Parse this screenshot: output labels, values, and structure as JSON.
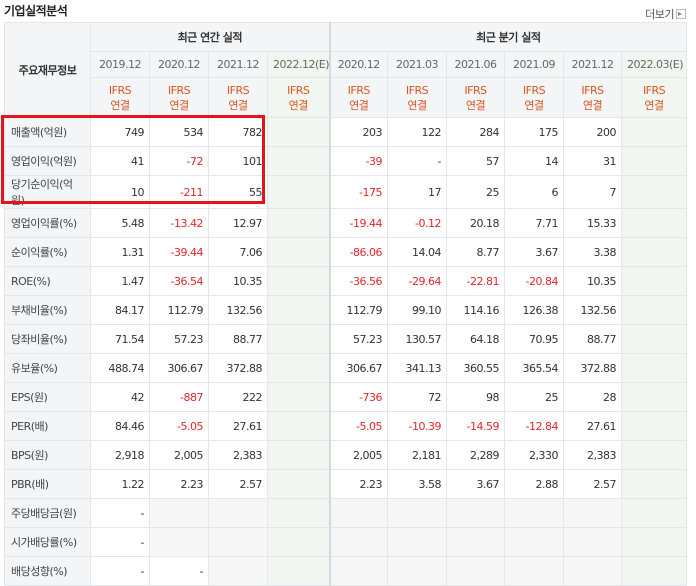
{
  "header": {
    "title": "기업실적분석",
    "more_label": "더보기"
  },
  "table": {
    "label_header": "주요재무정보",
    "group_annual": "최근 연간 실적",
    "group_quarter": "최근 분기 실적",
    "annual_periods": [
      "2019.12",
      "2020.12",
      "2021.12",
      "2022.12(E)"
    ],
    "quarter_periods": [
      "2020.12",
      "2021.03",
      "2021.06",
      "2021.09",
      "2021.12",
      "2022.03(E)"
    ],
    "basis_line1": "IFRS",
    "basis_line2": "연결",
    "rows": [
      {
        "label": "매출액(억원)",
        "annual": [
          "749",
          "534",
          "782",
          ""
        ],
        "quarter": [
          "203",
          "122",
          "284",
          "175",
          "200",
          ""
        ]
      },
      {
        "label": "영업이익(억원)",
        "annual": [
          "41",
          "-72",
          "101",
          ""
        ],
        "quarter": [
          "-39",
          "-",
          "57",
          "14",
          "31",
          ""
        ]
      },
      {
        "label": "당기순이익(억원)",
        "annual": [
          "10",
          "-211",
          "55",
          ""
        ],
        "quarter": [
          "-175",
          "17",
          "25",
          "6",
          "7",
          ""
        ]
      },
      {
        "label": "영업이익률(%)",
        "annual": [
          "5.48",
          "-13.42",
          "12.97",
          ""
        ],
        "quarter": [
          "-19.44",
          "-0.12",
          "20.18",
          "7.71",
          "15.33",
          ""
        ]
      },
      {
        "label": "순이익률(%)",
        "annual": [
          "1.31",
          "-39.44",
          "7.06",
          ""
        ],
        "quarter": [
          "-86.06",
          "14.04",
          "8.77",
          "3.67",
          "3.38",
          ""
        ]
      },
      {
        "label": "ROE(%)",
        "annual": [
          "1.47",
          "-36.54",
          "10.35",
          ""
        ],
        "quarter": [
          "-36.56",
          "-29.64",
          "-22.81",
          "-20.84",
          "10.35",
          ""
        ]
      },
      {
        "label": "부채비율(%)",
        "annual": [
          "84.17",
          "112.79",
          "132.56",
          ""
        ],
        "quarter": [
          "112.79",
          "99.10",
          "114.16",
          "126.38",
          "132.56",
          ""
        ]
      },
      {
        "label": "당좌비율(%)",
        "annual": [
          "71.54",
          "57.23",
          "88.77",
          ""
        ],
        "quarter": [
          "57.23",
          "130.57",
          "64.18",
          "70.95",
          "88.77",
          ""
        ]
      },
      {
        "label": "유보율(%)",
        "annual": [
          "488.74",
          "306.67",
          "372.88",
          ""
        ],
        "quarter": [
          "306.67",
          "341.13",
          "360.55",
          "365.54",
          "372.88",
          ""
        ]
      },
      {
        "label": "EPS(원)",
        "annual": [
          "42",
          "-887",
          "222",
          ""
        ],
        "quarter": [
          "-736",
          "72",
          "98",
          "25",
          "28",
          ""
        ]
      },
      {
        "label": "PER(배)",
        "annual": [
          "84.46",
          "-5.05",
          "27.61",
          ""
        ],
        "quarter": [
          "-5.05",
          "-10.39",
          "-14.59",
          "-12.84",
          "27.61",
          ""
        ]
      },
      {
        "label": "BPS(원)",
        "annual": [
          "2,918",
          "2,005",
          "2,383",
          ""
        ],
        "quarter": [
          "2,005",
          "2,181",
          "2,289",
          "2,330",
          "2,383",
          ""
        ]
      },
      {
        "label": "PBR(배)",
        "annual": [
          "1.22",
          "2.23",
          "2.57",
          ""
        ],
        "quarter": [
          "2.23",
          "3.58",
          "3.67",
          "2.88",
          "2.57",
          ""
        ]
      },
      {
        "label": "주당배당금(원)",
        "annual": [
          "-",
          "",
          "",
          ""
        ],
        "quarter": [
          "",
          "",
          "",
          "",
          "",
          ""
        ]
      },
      {
        "label": "시가배당률(%)",
        "annual": [
          "-",
          "",
          "",
          ""
        ],
        "quarter": [
          "",
          "",
          "",
          "",
          "",
          ""
        ]
      },
      {
        "label": "배당성향(%)",
        "annual": [
          "-",
          "-",
          "",
          ""
        ],
        "quarter": [
          "",
          "",
          "",
          "",
          "",
          ""
        ]
      }
    ]
  },
  "colors": {
    "highlight": "#e5131c",
    "negative": "#e0262b",
    "ifrs": "#d9541e",
    "estimate_bg": "#f1f6f0"
  }
}
